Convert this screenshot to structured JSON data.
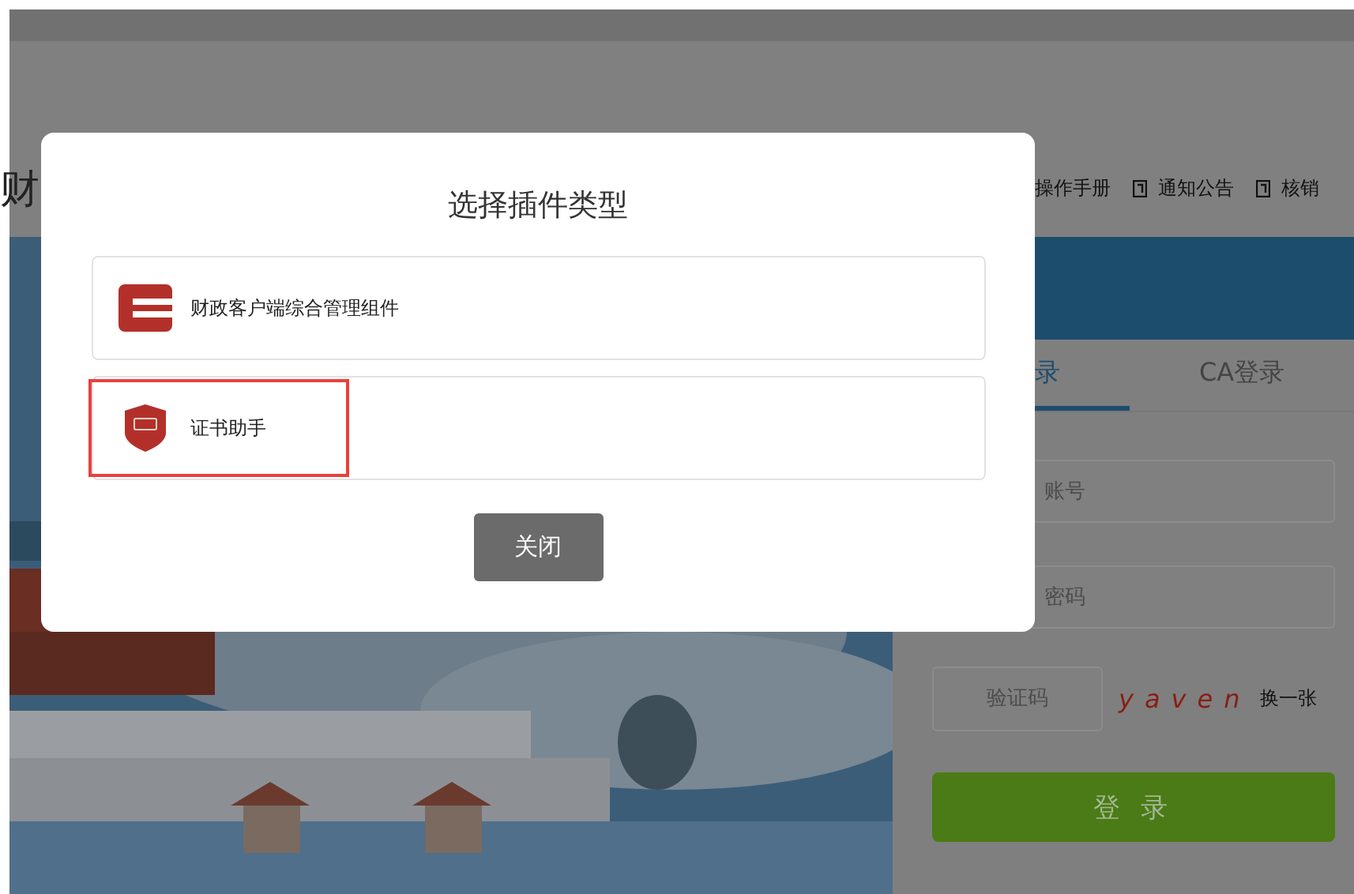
{
  "header": {
    "logo_text": "财",
    "links": [
      {
        "label": "操作手册",
        "icon": false
      },
      {
        "label": "通知公告",
        "icon": true
      },
      {
        "label": "核销",
        "icon": true
      }
    ]
  },
  "login": {
    "tabs": [
      {
        "label": "录",
        "selected": true
      },
      {
        "label": "CA登录",
        "selected": false
      }
    ],
    "account": {
      "placeholder": "账号"
    },
    "password": {
      "placeholder": "密码"
    },
    "captcha": {
      "placeholder": "验证码",
      "code": "yaven",
      "refresh": "换一张"
    },
    "submit": "登 录"
  },
  "dialog": {
    "title": "选择插件类型",
    "plugins": [
      {
        "kind": "finance",
        "label": "财政客户端综合管理组件",
        "selected": false
      },
      {
        "kind": "key",
        "label": "证书助手",
        "selected": true
      }
    ],
    "close": "关闭"
  }
}
